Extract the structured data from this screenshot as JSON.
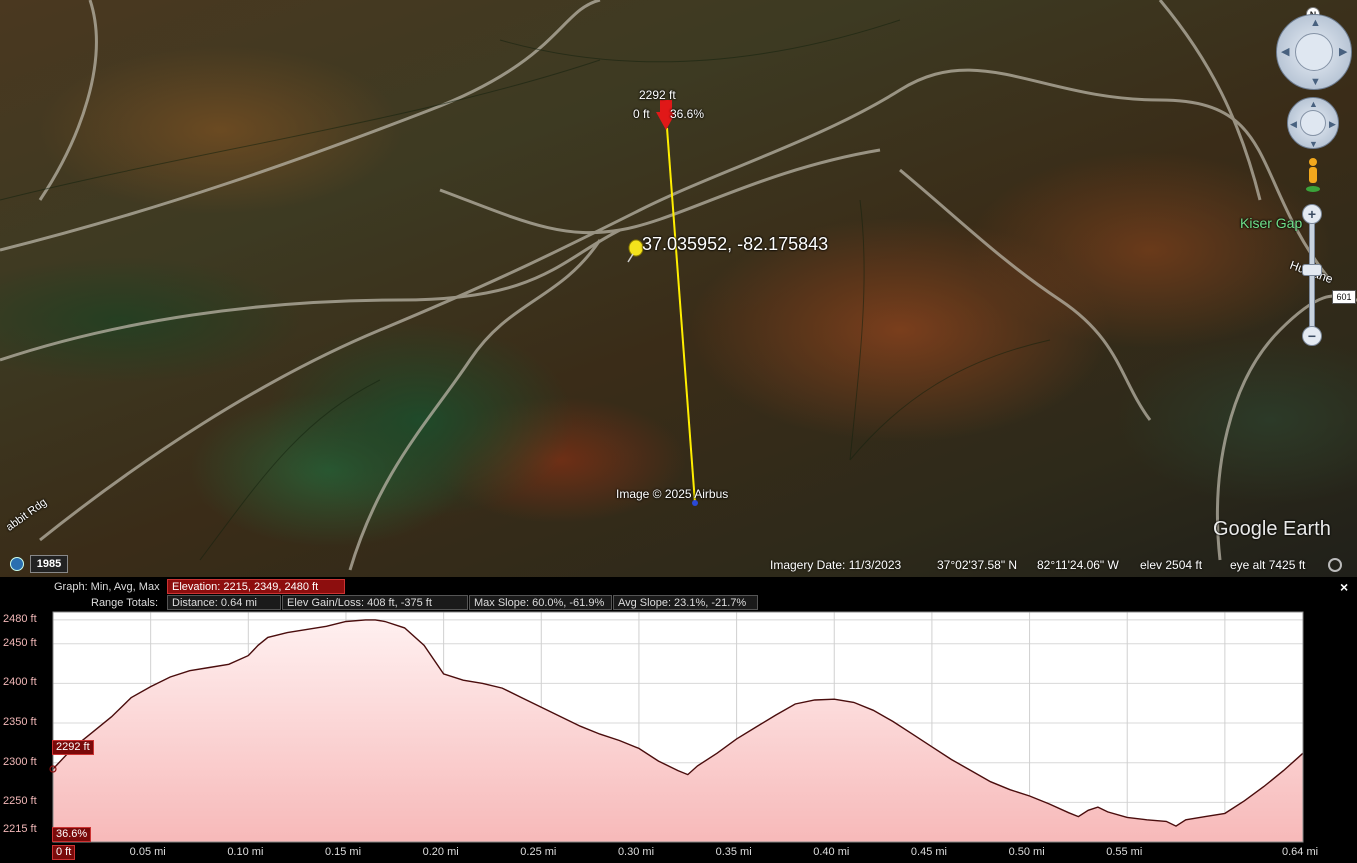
{
  "map": {
    "ruler_start": {
      "elevation": "2292 ft",
      "distance": "0 ft",
      "slope": "36.6%"
    },
    "placemark_label": "37.035952, -82.175843",
    "imagery_credit": "Image © 2025 Airbus",
    "place_labels": {
      "kiser_gap": "Kiser Gap",
      "road_left": "abbit Rdg",
      "road_right": "Hu cane",
      "route_shield": "601"
    },
    "logo": "Google Earth",
    "year_badge": "1985",
    "status": {
      "imagery_date": "Imagery Date: 11/3/2023",
      "lat": "37°02'37.58\" N",
      "lon": "82°11'24.06\" W",
      "elev": "elev  2504 ft",
      "eye_alt": "eye alt   7425 ft"
    },
    "nav": {
      "north": "N",
      "zoom_in": "+",
      "zoom_out": "−",
      "zoom_level": 0.45
    }
  },
  "profile": {
    "graph_label": "Graph: Min, Avg, Max",
    "range_label": "Range Totals:",
    "elevation_stats": "Elevation: 2215, 2349, 2480 ft",
    "distance_stats": "Distance: 0.64 mi",
    "gain_loss_stats": "Elev Gain/Loss: 408 ft, -375 ft",
    "max_slope_stats": "Max Slope: 60.0%, -61.9%",
    "avg_slope_stats": "Avg Slope: 23.1%, -21.7%",
    "close": "×",
    "cursor_tags": {
      "elevation": "2292 ft",
      "slope": "36.6%",
      "distance": "0 ft"
    },
    "colors": {
      "fill": "#f7b9b9",
      "line": "#4a0d0d",
      "accent": "#8d0e0e"
    }
  },
  "chart_data": {
    "type": "area",
    "xlabel": "",
    "ylabel": "",
    "x_unit": "mi",
    "y_unit": "ft",
    "xlim": [
      0,
      0.64
    ],
    "ylim": [
      2200,
      2490
    ],
    "y_ticks": [
      2215,
      2250,
      2300,
      2350,
      2400,
      2450,
      2480
    ],
    "y_tick_labels": [
      "2215 ft",
      "2250 ft",
      "2300 ft",
      "2350 ft",
      "2400 ft",
      "2450 ft",
      "2480 ft"
    ],
    "x_ticks": [
      0,
      0.05,
      0.1,
      0.15,
      0.2,
      0.25,
      0.3,
      0.35,
      0.4,
      0.45,
      0.5,
      0.55,
      0.64
    ],
    "x_tick_labels": [
      "0 ft",
      "0.05 mi",
      "0.10 mi",
      "0.15 mi",
      "0.20 mi",
      "0.25 mi",
      "0.30 mi",
      "0.35 mi",
      "0.40 mi",
      "0.45 mi",
      "0.50 mi",
      "0.55 mi",
      "0.64 mi"
    ],
    "grid": true,
    "x": [
      0,
      0.01,
      0.02,
      0.03,
      0.04,
      0.05,
      0.06,
      0.07,
      0.08,
      0.09,
      0.1,
      0.105,
      0.11,
      0.12,
      0.13,
      0.14,
      0.15,
      0.16,
      0.165,
      0.17,
      0.18,
      0.19,
      0.2,
      0.21,
      0.22,
      0.23,
      0.24,
      0.25,
      0.26,
      0.27,
      0.28,
      0.29,
      0.3,
      0.31,
      0.32,
      0.325,
      0.33,
      0.34,
      0.35,
      0.36,
      0.37,
      0.38,
      0.39,
      0.4,
      0.41,
      0.42,
      0.43,
      0.44,
      0.45,
      0.46,
      0.47,
      0.48,
      0.49,
      0.5,
      0.51,
      0.52,
      0.525,
      0.53,
      0.535,
      0.54,
      0.55,
      0.56,
      0.57,
      0.575,
      0.58,
      0.59,
      0.6,
      0.61,
      0.62,
      0.63,
      0.64
    ],
    "y": [
      2292,
      2318,
      2338,
      2358,
      2382,
      2396,
      2408,
      2416,
      2420,
      2424,
      2435,
      2448,
      2458,
      2464,
      2468,
      2472,
      2478,
      2480,
      2480,
      2478,
      2470,
      2448,
      2412,
      2404,
      2400,
      2394,
      2382,
      2370,
      2358,
      2346,
      2336,
      2328,
      2318,
      2302,
      2290,
      2285,
      2296,
      2312,
      2330,
      2345,
      2360,
      2374,
      2379,
      2380,
      2376,
      2366,
      2352,
      2336,
      2320,
      2304,
      2290,
      2276,
      2266,
      2258,
      2248,
      2237,
      2232,
      2240,
      2244,
      2238,
      2231,
      2228,
      2226,
      2220,
      2228,
      2232,
      2236,
      2252,
      2270,
      2290,
      2312
    ]
  }
}
